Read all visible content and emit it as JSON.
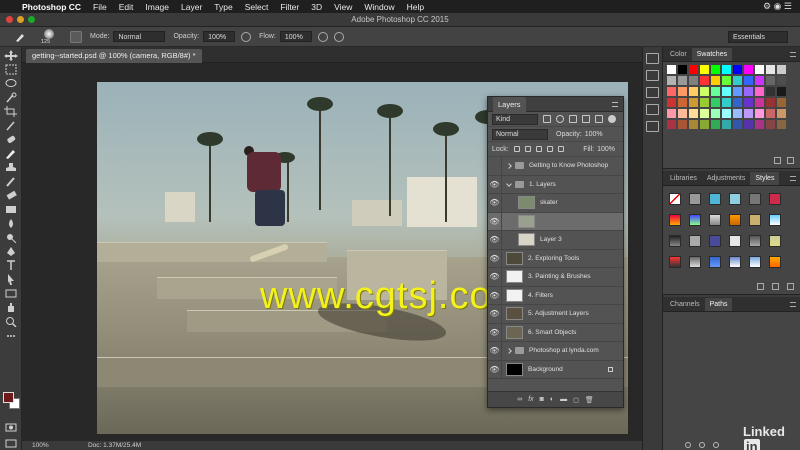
{
  "menubar": {
    "app_name": "Photoshop CC",
    "items": [
      "File",
      "Edit",
      "Image",
      "Layer",
      "Type",
      "Select",
      "Filter",
      "3D",
      "View",
      "Window",
      "Help"
    ]
  },
  "window": {
    "title": "Adobe Photoshop CC 2015"
  },
  "options": {
    "brush_size": "125",
    "mode_label": "Mode:",
    "mode_value": "Normal",
    "opacity_label": "Opacity:",
    "opacity_value": "100%",
    "flow_label": "Flow:",
    "flow_value": "100%",
    "workspace": "Essentials"
  },
  "document": {
    "tab_title": "getting--started.psd @ 100% (camera, RGB/8#) *",
    "zoom": "100%",
    "doc_info": "Doc: 1.37M/25.4M"
  },
  "watermark": "www.cgtsj.com",
  "layers_panel": {
    "title": "Layers",
    "kind": "Kind",
    "blend_mode": "Normal",
    "opacity_label": "Opacity:",
    "opacity_value": "100%",
    "lock_label": "Lock:",
    "fill_label": "Fill:",
    "fill_value": "100%",
    "layers": [
      {
        "name": "Getting to Know Photoshop",
        "type": "group",
        "expanded": false,
        "visible": false
      },
      {
        "name": "1. Layers",
        "type": "group",
        "expanded": true,
        "visible": true
      },
      {
        "name": "skater",
        "type": "layer",
        "visible": true
      },
      {
        "name": "",
        "type": "layer",
        "visible": true,
        "selected": true
      },
      {
        "name": "Layer 3",
        "type": "layer",
        "visible": true
      },
      {
        "name": "2. Exploring Tools",
        "type": "layer",
        "visible": true
      },
      {
        "name": "3. Painting & Brushes",
        "type": "layer",
        "visible": true
      },
      {
        "name": "4. Filters",
        "type": "layer",
        "visible": true
      },
      {
        "name": "5. Adjustment Layers",
        "type": "layer",
        "visible": true
      },
      {
        "name": "6. Smart Objects",
        "type": "layer",
        "visible": true
      },
      {
        "name": "Photoshop at lynda.com",
        "type": "group",
        "expanded": false,
        "visible": true
      },
      {
        "name": "Background",
        "type": "layer",
        "visible": true,
        "locked": true
      }
    ],
    "footer_icons": [
      "link-icon",
      "fx-icon",
      "mask-icon",
      "adjustment-icon",
      "folder-icon",
      "new-layer-icon",
      "trash-icon"
    ]
  },
  "swatches_panel": {
    "tabs": [
      "Color",
      "Swatches"
    ],
    "active_tab": "Swatches"
  },
  "styles_panel": {
    "tabs": [
      "Libraries",
      "Adjustments",
      "Styles"
    ],
    "active_tab": "Styles"
  },
  "paths_panel": {
    "tabs": [
      "Channels",
      "Paths"
    ],
    "active_tab": "Paths"
  },
  "branding": {
    "name": "Linked",
    "badge": "in"
  },
  "colors": {
    "foreground": "#6e1a1a",
    "background": "#ffffff",
    "watermark": "#f4f21a"
  }
}
